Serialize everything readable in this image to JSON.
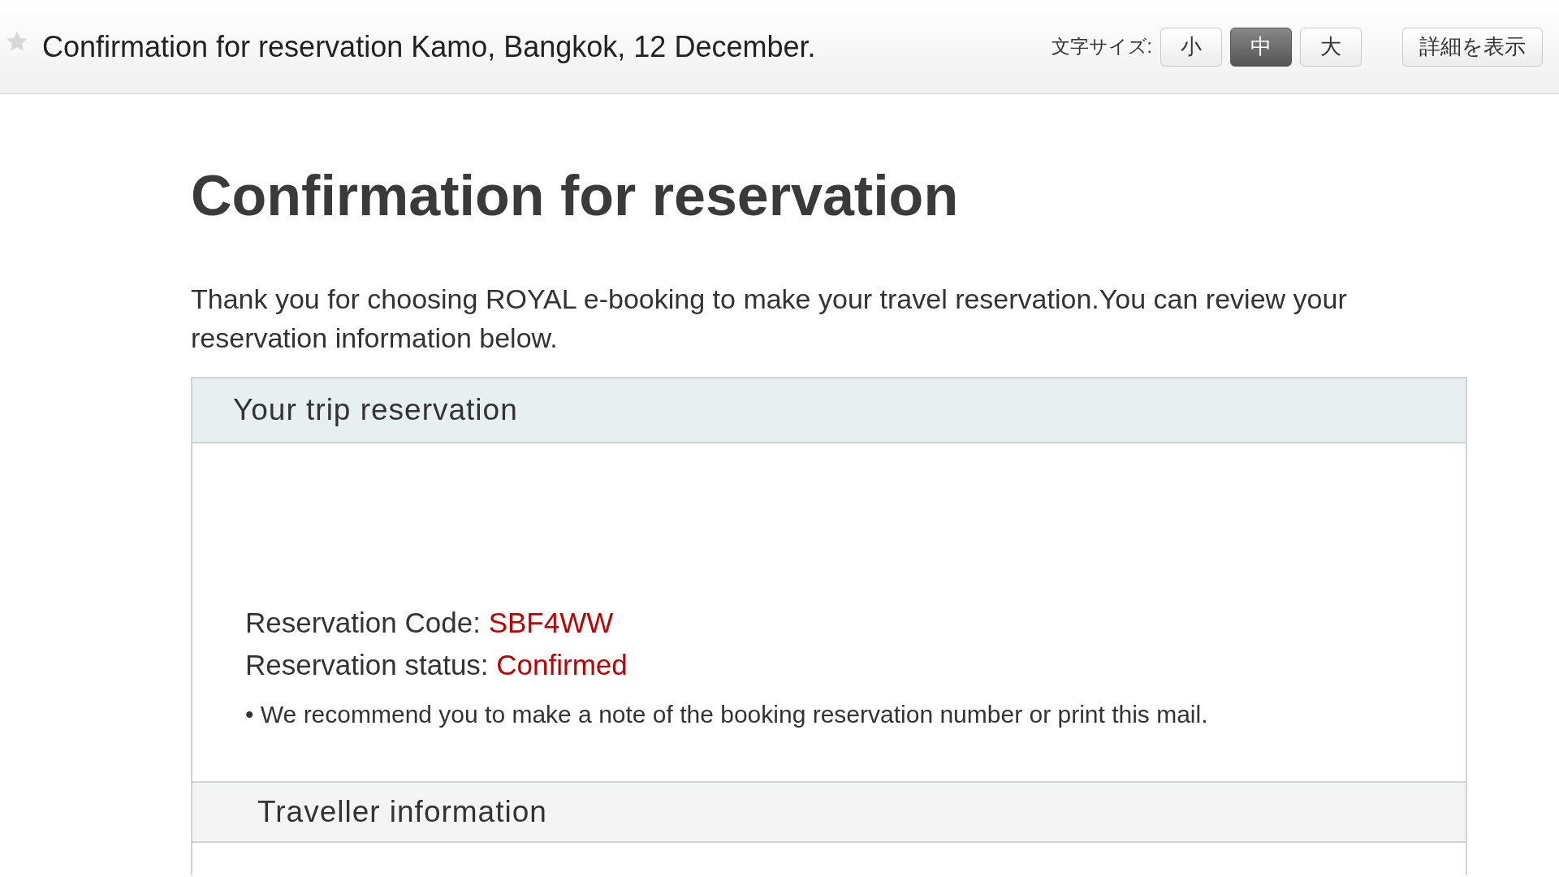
{
  "header": {
    "starred": false,
    "subject": "Confirmation for reservation Kamo, Bangkok, 12 December.",
    "font_size_label": "文字サイズ:",
    "font_sizes": [
      {
        "label": "小",
        "selected": false
      },
      {
        "label": "中",
        "selected": true
      },
      {
        "label": "大",
        "selected": false
      }
    ],
    "details_button": "詳細を表示"
  },
  "body": {
    "heading": "Confirmation for reservation",
    "intro": "Thank you for choosing ROYAL e-booking to make your travel reservation.You can review your reservation information below.",
    "trip": {
      "title": "Your trip reservation",
      "fields": [
        {
          "label": "Reservation Code:",
          "value": "SBF4WW"
        },
        {
          "label": "Reservation status:",
          "value": "Confirmed"
        }
      ],
      "note": "• We recommend you to make a note of the booking reservation number or print this mail."
    },
    "traveller": {
      "title": "Traveller information"
    }
  }
}
